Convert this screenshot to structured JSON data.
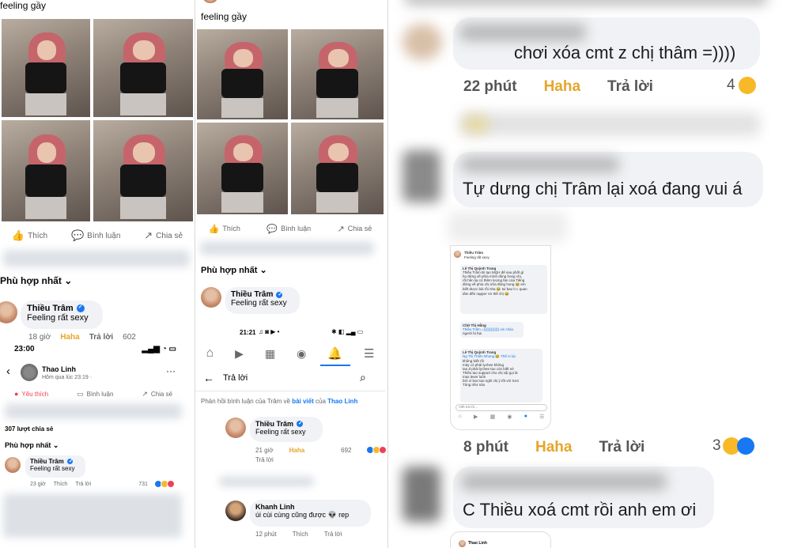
{
  "panel1": {
    "header_text": "feeling gầy",
    "actions": {
      "like": "Thích",
      "comment": "Bình luận",
      "share": "Chia sẻ"
    },
    "sort_label": "Phù hợp nhất",
    "comment": {
      "author": "Thiều Trâm",
      "text": "Feeling rất sexy",
      "time": "18 giờ",
      "reaction": "Haha",
      "reply": "Trả lời",
      "count": "602"
    },
    "phone": {
      "status_time": "23:00",
      "author": "Thao Linh",
      "post_meta": "Hôm qua lúc 23:19 · ",
      "actions": {
        "like": "Yêu thích",
        "comment": "Bình luận",
        "share": "Chia sẻ"
      },
      "shares": "307 lượt chia sẻ",
      "sort_label": "Phù hợp nhất",
      "comment": {
        "author": "Thiều Trâm",
        "text": "Feeling rất sexy",
        "time": "23 giờ",
        "like": "Thích",
        "reply": "Trả lời",
        "count": "731"
      }
    }
  },
  "panel2": {
    "header_text": "feeling gầy",
    "actions": {
      "like": "Thích",
      "comment": "Bình luận",
      "share": "Chia sẻ"
    },
    "sort_label": "Phù hợp nhất",
    "comment": {
      "author": "Thiều Trâm",
      "text": "Feeling rất sexy"
    },
    "phone": {
      "status_time": "21:21",
      "reply_title": "Trả lời",
      "context_prefix": "Phản hồi bình luận của Trâm về ",
      "context_link1": "bài viết",
      "context_mid": " của ",
      "context_link2": "Thao Linh",
      "comment": {
        "author": "Thiều Trâm",
        "text": "Feeling rất sexy",
        "time": "21 giờ",
        "reaction": "Haha",
        "reply": "Trả lời",
        "count": "692"
      },
      "reply_comment": {
        "author": "Khanh Linh",
        "text": "úi cùi cùng cũng được 👽 rep",
        "time": "12 phút",
        "like": "Thích",
        "reply": "Trả lời"
      }
    }
  },
  "panel3": {
    "comment1": {
      "text": "chơi xóa cmt z chị thâm =))))",
      "time": "22 phút",
      "reaction": "Haha",
      "reply": "Trả lời",
      "count": "4"
    },
    "comment2": {
      "text": "Tự dưng chị Trâm lại xoá đang vui á"
    },
    "embedded_shot": {
      "author": "Thiều Trâm",
      "text": "Feeling rất sexy",
      "reply_author": "Lê Thị Quỳnh Trang",
      "reply_lines": [
        "Thiều Trâm Đi tạo MQH để sau phốt gì",
        "họ đứng về phía mình đúng hong chị,",
        "rồi hên lại có thêm lượng fan của Tiêng",
        "đứng về phía chị nữa đúng hong 😂 em",
        "biết được bài rồi nha 😂 tui bao h c quan",
        "tâm đến rapper Vn thế chị 😂"
      ],
      "reply2_author": "Chữ Thị Hằng",
      "reply2_lines": [
        "Thiều Trâm =))))))))))))) xin chào",
        "người bị hại"
      ],
      "reply3_author": "Lê Thị Quỳnh Trang",
      "reply3_lines": [
        "Ng Thị Thiên Nhung 😂 Thế m lại",
        "không biết rồi",
        "máy có phải lychee không",
        "tao đ phải lychee tao còn biết nè",
        "Thiều tao support cho chị vậi gọi là",
        "max lever luôn",
        "bởi vì bọn tao nghỉ chị ý tốt với Sơn",
        "Tùng như nào"
      ],
      "input_placeholder": "Viết trả lời..."
    },
    "comment3": {
      "time": "8 phút",
      "reaction": "Haha",
      "reply": "Trả lời",
      "count": "3"
    },
    "comment4": {
      "text": "C Thiều xoá cmt rồi anh em ơi"
    },
    "bottom_author": "Thao Linh"
  }
}
